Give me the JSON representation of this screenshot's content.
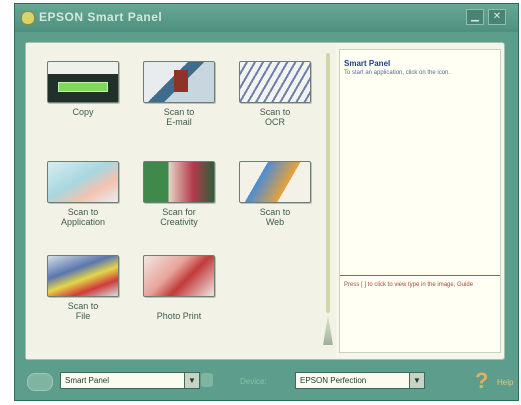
{
  "window": {
    "title": "EPSON Smart Panel",
    "minimize_glyph": "▁",
    "close_glyph": "✕"
  },
  "applications": [
    {
      "id": "copy",
      "label": "Copy",
      "icon": "scanner-copy-icon"
    },
    {
      "id": "scan-email",
      "label": "Scan to\nE-mail",
      "icon": "email-photo-icon"
    },
    {
      "id": "scan-ocr",
      "label": "Scan to\nOCR",
      "icon": "ocr-document-icon"
    },
    {
      "id": "scan-application",
      "label": "Scan to\nApplication",
      "icon": "application-icon"
    },
    {
      "id": "scan-creativity",
      "label": "Scan for\nCreativity",
      "icon": "creativity-icon"
    },
    {
      "id": "scan-web",
      "label": "Scan to\nWeb",
      "icon": "web-icon"
    },
    {
      "id": "scan-file",
      "label": "Scan to\nFile",
      "icon": "file-folders-icon"
    },
    {
      "id": "photo-print",
      "label": "Photo Print",
      "icon": "photo-print-icon"
    }
  ],
  "info": {
    "title": "Smart Panel",
    "description": "To start an application, click on the icon.",
    "help": "Press [ ] to click to view type in the image, Guide"
  },
  "bottom": {
    "panel_select_value": "Smart Panel",
    "device_label": "Device:",
    "device_select_value": "EPSON Perfection",
    "help_glyph": "?",
    "help_label": "Help"
  }
}
